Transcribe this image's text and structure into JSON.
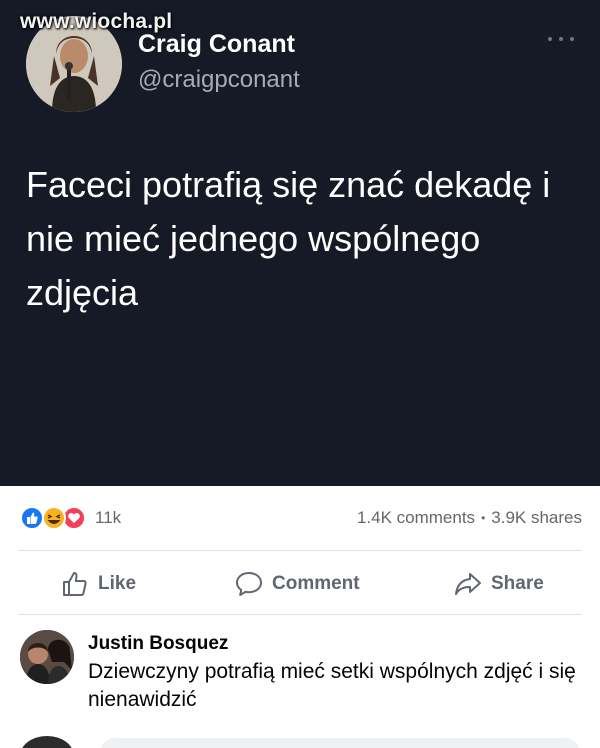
{
  "watermark": "www.wiocha.pl",
  "tweet": {
    "name": "Craig Conant",
    "handle": "@craigpconant",
    "text": "Faceci potrafią się znać dekadę i nie mieć jednego wspólnego zdjęcia"
  },
  "stats": {
    "reactions": [
      "like-reaction-icon",
      "haha-reaction-icon",
      "love-reaction-icon"
    ],
    "reaction_count": "11k",
    "comments": "1.4K comments",
    "separator": "•",
    "shares": "3.9K shares"
  },
  "actions": {
    "like": "Like",
    "comment": "Comment",
    "share": "Share"
  },
  "comment": {
    "author": "Justin Bosquez",
    "text": "Dziewczyny potrafią mieć setki wspólnych zdjęć i się nienawidzić"
  },
  "colors": {
    "tweet_bg": "#151a26",
    "like_blue": "#1877f2",
    "love_red": "#f33e58",
    "haha_yellow": "#f7b125",
    "muted_text": "#65676b"
  }
}
